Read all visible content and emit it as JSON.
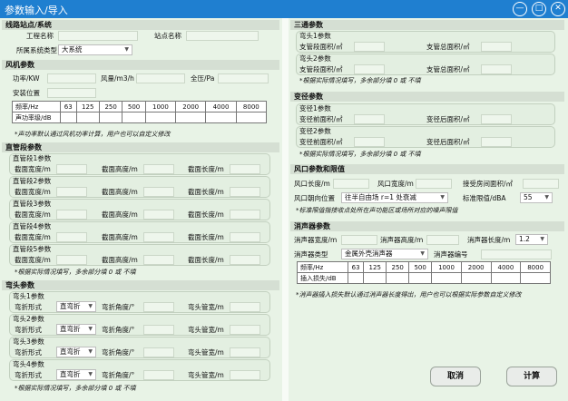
{
  "window": {
    "title": "参数输入/导入",
    "btn_minimize": "—",
    "btn_maximize": "□",
    "btn_close": "✕"
  },
  "line_station": {
    "section": "线路站点/系统",
    "project_name": "工程名称",
    "station_name": "站点名称",
    "system_type_label": "所属系统类型",
    "system_type": "大系统"
  },
  "fan": {
    "section": "风机参数",
    "power": "功率/KW",
    "airflow": "风量/m3/h",
    "pressure": "全压/Pa",
    "install_pos": "安装位置",
    "freq_header": "频率/Hz",
    "spl_header": "声功率级/dB",
    "freqs": [
      "63",
      "125",
      "250",
      "500",
      "1000",
      "2000",
      "4000",
      "8000"
    ],
    "note": "*声功率默认通过风机功率计算，用户也可以自定义修改"
  },
  "straight": {
    "section": "直管段参数",
    "groups": [
      "直管段1参数",
      "直管段2参数",
      "直管段3参数",
      "直管段4参数",
      "直管段5参数"
    ],
    "width": "截面宽度/m",
    "height": "截面高度/m",
    "length": "截面长度/m",
    "note": "*根据实际情况填写，多余部分填 0 或 不填"
  },
  "elbow": {
    "section": "弯头参数",
    "groups": [
      "弯头1参数",
      "弯头2参数",
      "弯头3参数",
      "弯头4参数"
    ],
    "form_label": "弯折形式",
    "form_value": "直弯折",
    "angle": "弯折角度/°",
    "pipe_width": "弯头管宽/m",
    "note": "*根据实际情况填写，多余部分填 0 或 不填"
  },
  "tee": {
    "section": "三通参数",
    "groups": [
      "弯头1参数",
      "弯头2参数"
    ],
    "branch_area": "支管段面积/㎡",
    "total_area": "支管总面积/㎡",
    "note": "*根据实际情况填写，多余部分填 0 或 不填"
  },
  "reducer": {
    "section": "变径参数",
    "groups": [
      "变径1参数",
      "变径2参数"
    ],
    "before": "变径前面积/㎡",
    "after": "变径后面积/㎡",
    "note": "*根据实际情况填写，多余部分填 0 或 不填"
  },
  "outlet": {
    "section": "风口参数和限值",
    "length": "风口长度/m",
    "width": "风口宽度/m",
    "recv_area": "接受房间面积/㎡",
    "position_label": "风口朝向位置",
    "position_value": "往半自由场 r=1 处衰减",
    "limit_label": "标准限值/dBA",
    "limit_value": "55",
    "note": "*标准限值指接收点处所在声功能区或场所对应的噪声限值"
  },
  "silencer": {
    "section": "消声器参数",
    "width": "消声器宽度/m",
    "height": "消声器高度/m",
    "length": "消声器长度/m",
    "length_value": "1.2",
    "type_label": "消声器类型",
    "type_value": "金属外壳消声器",
    "code_label": "消声器编号",
    "freq_header": "频率/Hz",
    "loss_header": "插入损失/dB",
    "freqs": [
      "63",
      "125",
      "250",
      "500",
      "1000",
      "2000",
      "4000",
      "8000"
    ],
    "note": "*消声器插入损失默认通过消声器长度得出，用户也可以根据实际参数自定义修改"
  },
  "actions": {
    "cancel": "取消",
    "calculate": "计算"
  }
}
